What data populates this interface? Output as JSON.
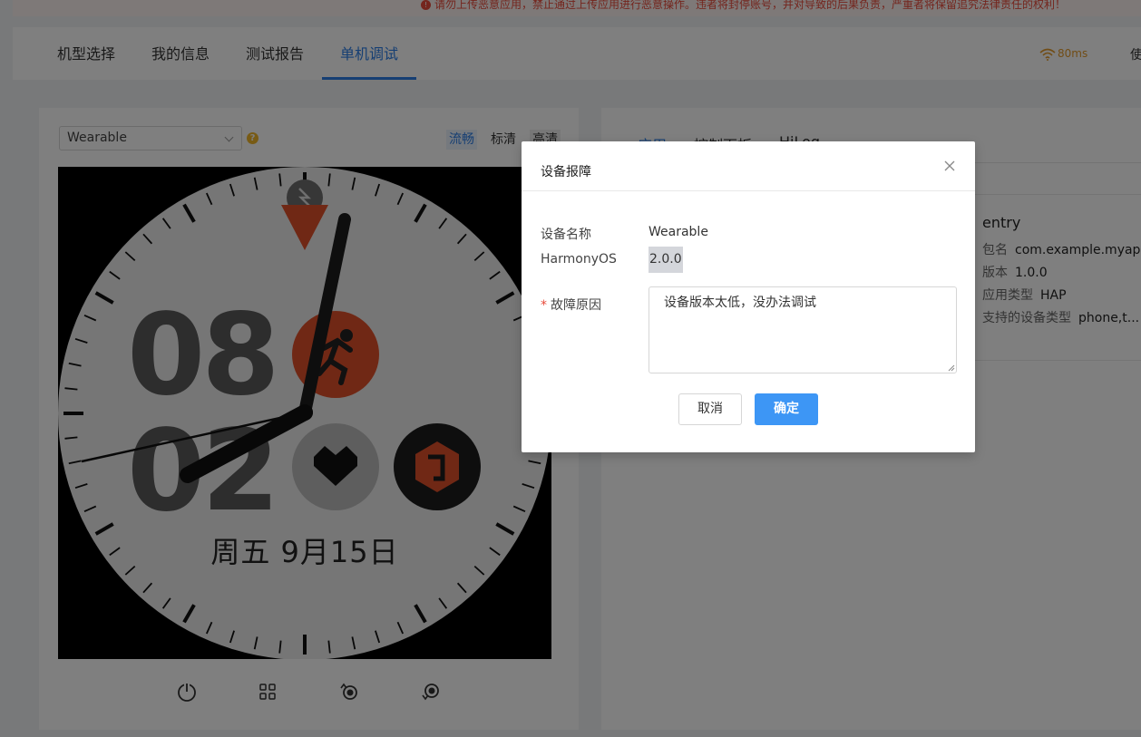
{
  "notice": {
    "text": "请勿上传恶意应用，禁止通过上传应用进行恶意操作。违者将封停账号，并对导致的后果负责，严重者将保留追究法律责任的权利！"
  },
  "nav": {
    "tabs": [
      {
        "label": "机型选择"
      },
      {
        "label": "我的信息"
      },
      {
        "label": "测试报告"
      },
      {
        "label": "单机调试"
      }
    ],
    "active_tab": "单机调试",
    "latency": "80ms",
    "more_label": "使"
  },
  "device": {
    "selected": "Wearable",
    "help": "?",
    "quality_options": [
      "流畅",
      "标清",
      "高清"
    ],
    "quality_selected": "流畅"
  },
  "watch": {
    "hour_digits": "08",
    "minute_digits": "02",
    "date": "周五 9月15日",
    "accent_color": "#e0502a"
  },
  "controls": [
    "power-icon",
    "apps-grid-icon",
    "rotate-left-icon",
    "rotate-right-icon"
  ],
  "right_panel": {
    "tabs": [
      {
        "label": "应用"
      },
      {
        "label": "控制面板"
      },
      {
        "label": "HiLog"
      }
    ],
    "active_tab": "应用",
    "app": {
      "name": "entry",
      "rows": [
        {
          "key": "包名",
          "value": "com.example.myap..."
        },
        {
          "key": "版本",
          "value": "1.0.0"
        },
        {
          "key": "应用类型",
          "value": "HAP"
        },
        {
          "key": "支持的设备类型",
          "value": "phone,t..."
        }
      ]
    }
  },
  "dialog": {
    "title": "设备报障",
    "device_name_label": "设备名称",
    "device_name": "Wearable",
    "os_label": "HarmonyOS",
    "os_version": "2.0.0",
    "reason_required": "*",
    "reason_label": "故障原因",
    "reason_value": "设备版本太低，没办法调试",
    "cancel_label": "取消",
    "ok_label": "确定",
    "ok_color": "#3d96f5"
  }
}
